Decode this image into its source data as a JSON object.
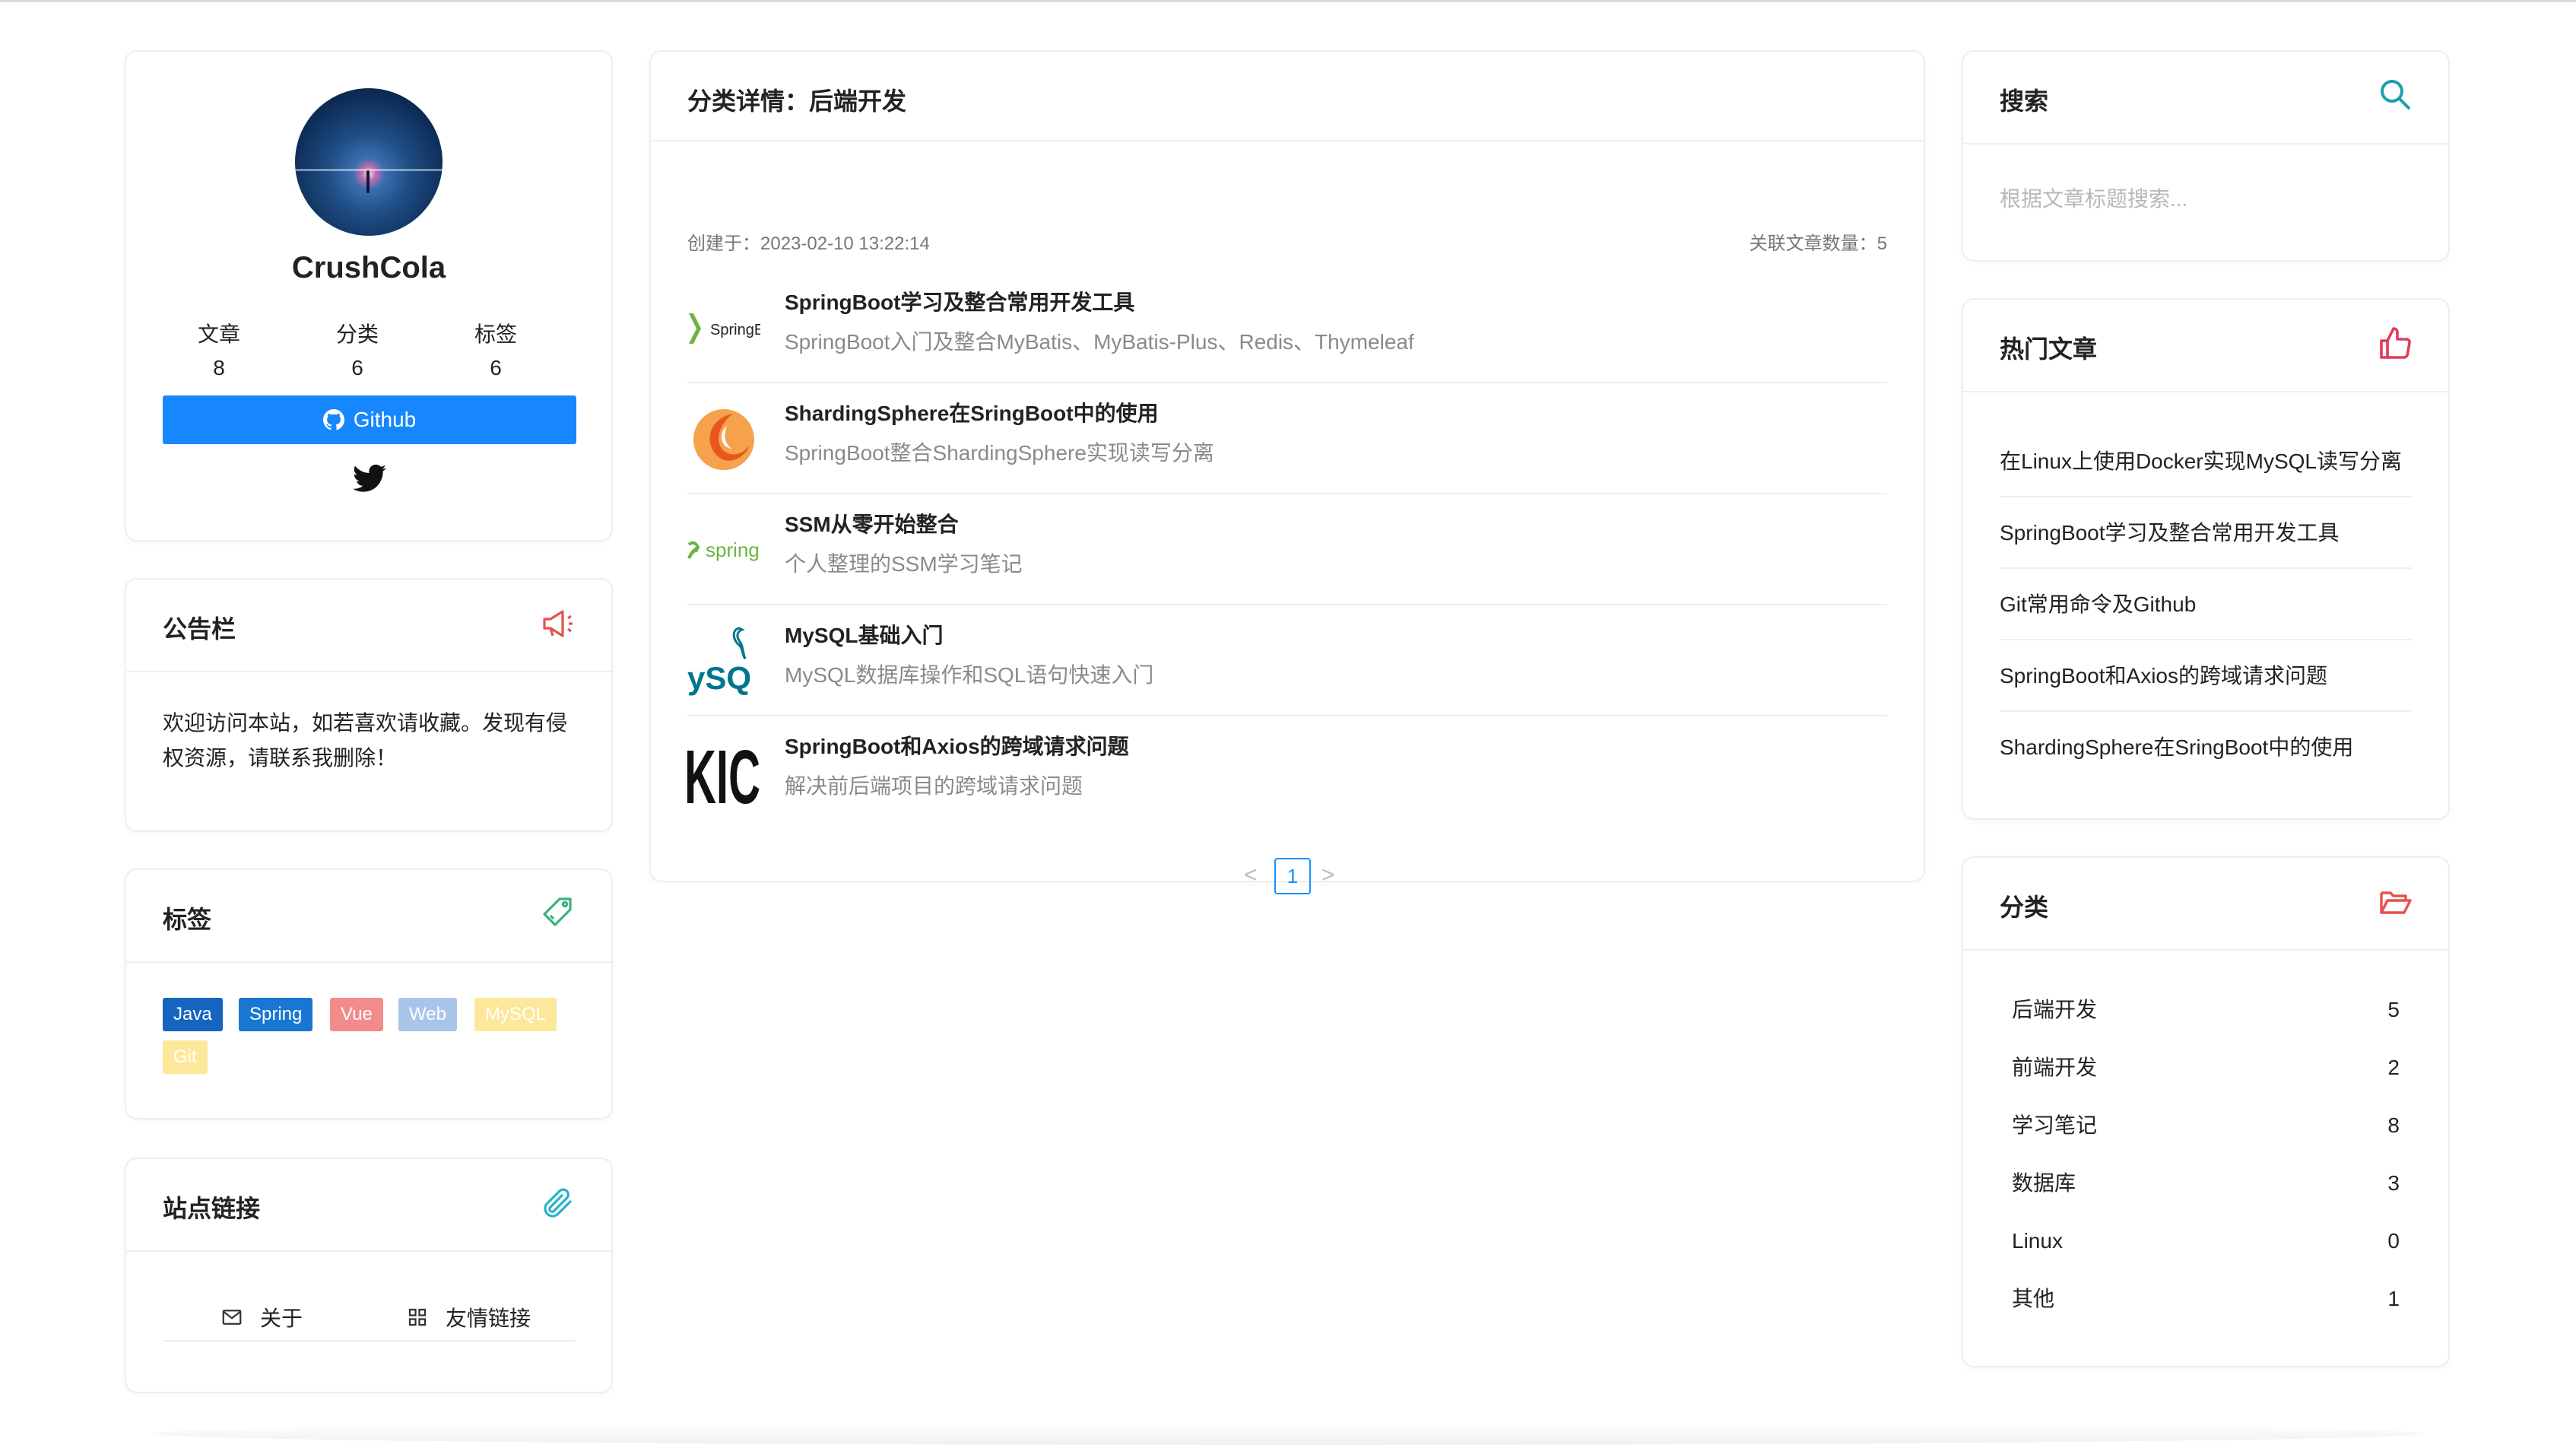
{
  "profile": {
    "name": "CrushCola",
    "stats": [
      {
        "label": "文章",
        "value": "8"
      },
      {
        "label": "分类",
        "value": "6"
      },
      {
        "label": "标签",
        "value": "6"
      }
    ],
    "github_label": "Github"
  },
  "notice": {
    "title": "公告栏",
    "text": "欢迎访问本站，如若喜欢请收藏。发现有侵权资源，请联系我删除！"
  },
  "tags": {
    "title": "标签",
    "items": [
      {
        "label": "Java",
        "color": "#1565c0"
      },
      {
        "label": "Spring",
        "color": "#1976d2"
      },
      {
        "label": "Vue",
        "color": "#f28b8b"
      },
      {
        "label": "Web",
        "color": "#a9c4ea"
      },
      {
        "label": "MySQL",
        "color": "#fde79b"
      },
      {
        "label": "Git",
        "color": "#fde79b"
      }
    ]
  },
  "site_links": {
    "title": "站点链接",
    "items": [
      {
        "label": "关于",
        "icon": "mail-icon"
      },
      {
        "label": "友情链接",
        "icon": "grid-icon"
      }
    ]
  },
  "category_detail": {
    "title": "分类详情：后端开发",
    "created": "创建于：2023-02-10 13:22:14",
    "article_count": "关联文章数量：5",
    "articles": [
      {
        "title": "SpringBoot学习及整合常用开发工具",
        "desc": "SpringBoot入门及整合MyBatis、MyBatis-Plus、Redis、Thymeleaf",
        "thumb": "springboot-logo",
        "thumb_text": "SpringE"
      },
      {
        "title": "ShardingSphere在SringBoot中的使用",
        "desc": "SpringBoot整合ShardingSphere实现读写分离",
        "thumb": "shardingsphere-logo",
        "thumb_text": ""
      },
      {
        "title": "SSM从零开始整合",
        "desc": "个人整理的SSM学习笔记",
        "thumb": "spring-logo",
        "thumb_text": "spring"
      },
      {
        "title": "MySQL基础入门",
        "desc": "MySQL数据库操作和SQL语句快速入门",
        "thumb": "mysql-logo",
        "thumb_text": "ySQ"
      },
      {
        "title": "SpringBoot和Axios的跨域请求问题",
        "desc": "解决前后端项目的跨域请求问题",
        "thumb": "axios-logo",
        "thumb_text": "KIC"
      }
    ],
    "pagination": {
      "current": "1",
      "prev": "<",
      "next": ">"
    }
  },
  "search": {
    "title": "搜索",
    "placeholder": "根据文章标题搜索..."
  },
  "hot": {
    "title": "热门文章",
    "items": [
      "在Linux上使用Docker实现MySQL读写分离",
      "SpringBoot学习及整合常用开发工具",
      "Git常用命令及Github",
      "SpringBoot和Axios的跨域请求问题",
      "ShardingSphere在SringBoot中的使用"
    ]
  },
  "categories": {
    "title": "分类",
    "items": [
      {
        "name": "后端开发",
        "count": "5"
      },
      {
        "name": "前端开发",
        "count": "2"
      },
      {
        "name": "学习笔记",
        "count": "8"
      },
      {
        "name": "数据库",
        "count": "3"
      },
      {
        "name": "Linux",
        "count": "0"
      },
      {
        "name": "其他",
        "count": "1"
      }
    ]
  }
}
